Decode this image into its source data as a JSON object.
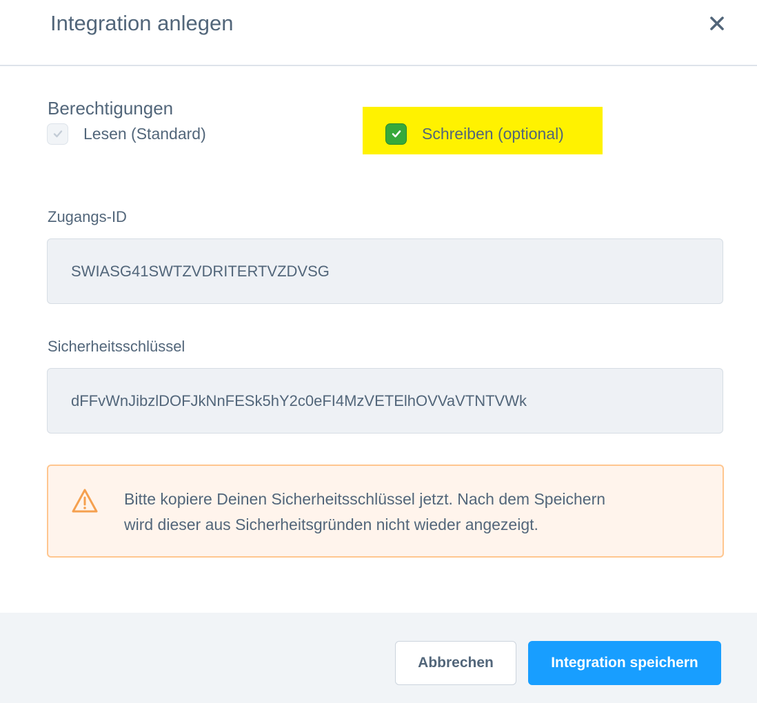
{
  "modal": {
    "title": "Integration anlegen",
    "close_icon": "close-icon"
  },
  "permissions": {
    "heading": "Berechtigungen",
    "read": {
      "label": "Lesen (Standard)",
      "checked": true,
      "disabled": true
    },
    "write": {
      "label": "Schreiben (optional)",
      "checked": true,
      "highlight_color": "#fff200"
    }
  },
  "access_id": {
    "label": "Zugangs-ID",
    "value": "SWIASG41SWTZVDRITERTVZDVSG"
  },
  "secret_key": {
    "label": "Sicherheitsschlüssel",
    "value": "dFFvWnJibzlDOFJkNnFESk5hY2c0eFI4MzVETElhOVVaVTNTVWk"
  },
  "alert": {
    "icon": "warning-icon",
    "text_line1": "Bitte kopiere Deinen Sicherheitsschlüssel jetzt. Nach dem Speichern",
    "text_line2": "wird dieser aus Sicherheitsgründen nicht wieder angezeigt."
  },
  "footer": {
    "cancel_label": "Abbrechen",
    "save_label": "Integration speichern"
  },
  "colors": {
    "primary": "#189eff",
    "checkbox_checked": "#37a93b",
    "warning_border": "#ffc68f",
    "warning_bg": "#fff4ec",
    "text": "#52667a"
  }
}
